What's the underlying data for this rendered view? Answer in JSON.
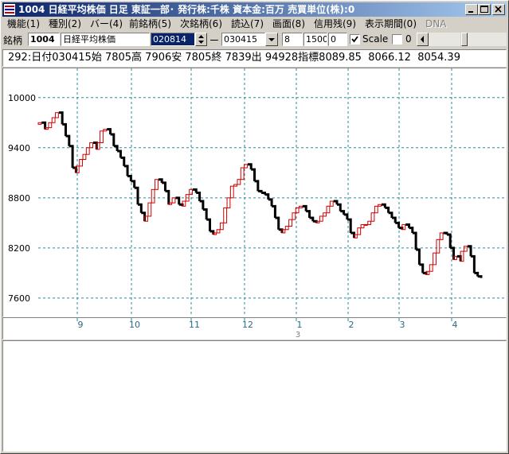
{
  "window": {
    "title": "1004 日経平均株価  日足  東証一部･  発行株:千株  資本金:百万  売買単位(株):0"
  },
  "menu": [
    "機能(1)",
    "種別(2)",
    "バー(4)",
    "前銘柄(5)",
    "次銘柄(6)",
    "読込(7)",
    "画面(8)",
    "信用残(9)",
    "表示期間(0)",
    "DNA"
  ],
  "toolbar": {
    "label": "銘柄",
    "code": "1004",
    "name": "日経平均株価",
    "date_from": "020814",
    "dash": "ー",
    "date_to": "030415",
    "field1": "8",
    "field2": "1500",
    "field3": "0",
    "scale_label": "Scale",
    "scale_checked": true,
    "field4": "0"
  },
  "info": {
    "text": "292:日付030415始 7805高 7906安 7805終 7839出 94928指標8089.85  8066.12  8054.39"
  },
  "colors": {
    "grid": "#2a8a9a",
    "candle_up": "#d00000",
    "candle_down": "#000000",
    "axis_text": "#2a6a8a"
  },
  "chart_data": {
    "type": "line",
    "series": [
      {
        "values": [
          9680,
          9700,
          9620,
          9640,
          9700,
          9760,
          9820,
          9680,
          9540,
          9420,
          9160,
          9100,
          9180,
          9260,
          9320,
          9400,
          9460,
          9380,
          9460,
          9600,
          9620,
          9560,
          9420,
          9360,
          9280,
          9180,
          9060,
          9000,
          8920,
          8720,
          8620,
          8520,
          8580,
          8740,
          8900,
          9020,
          8980,
          8880,
          8720,
          8740,
          8800,
          8720,
          8700,
          8760,
          8840,
          8900,
          8860,
          8760,
          8660,
          8540,
          8400,
          8360,
          8380,
          8420,
          8500,
          8680,
          8800,
          8940,
          8960,
          9020,
          9160,
          9200,
          9140,
          9000,
          8880,
          8860,
          8840,
          8780,
          8700,
          8560,
          8420,
          8380,
          8420,
          8460,
          8540,
          8620,
          8680,
          8700,
          8640,
          8560,
          8520,
          8500,
          8520,
          8580,
          8620,
          8700,
          8760,
          8720,
          8640,
          8600,
          8540,
          8380,
          8320,
          8360,
          8440,
          8480,
          8480,
          8520,
          8620,
          8700,
          8720,
          8680,
          8620,
          8560,
          8500,
          8440,
          8420,
          8480,
          8440,
          8380,
          8180,
          8000,
          7900,
          7880,
          7920,
          8000,
          8140,
          8300,
          8380,
          8360,
          8200,
          8060,
          8100,
          8040,
          8160,
          8220,
          8100,
          7900,
          7860,
          7840
        ]
      }
    ],
    "xlabels": [
      "9",
      "10",
      "11",
      "12",
      "1",
      "2",
      "3",
      "4"
    ],
    "year_label": "3",
    "ylabels": [
      "10000",
      "9400",
      "8800",
      "8200",
      "7600"
    ],
    "yticks": [
      10000,
      9400,
      8800,
      8200,
      7600
    ],
    "ylim": [
      7380,
      10350
    ],
    "grid": true
  }
}
